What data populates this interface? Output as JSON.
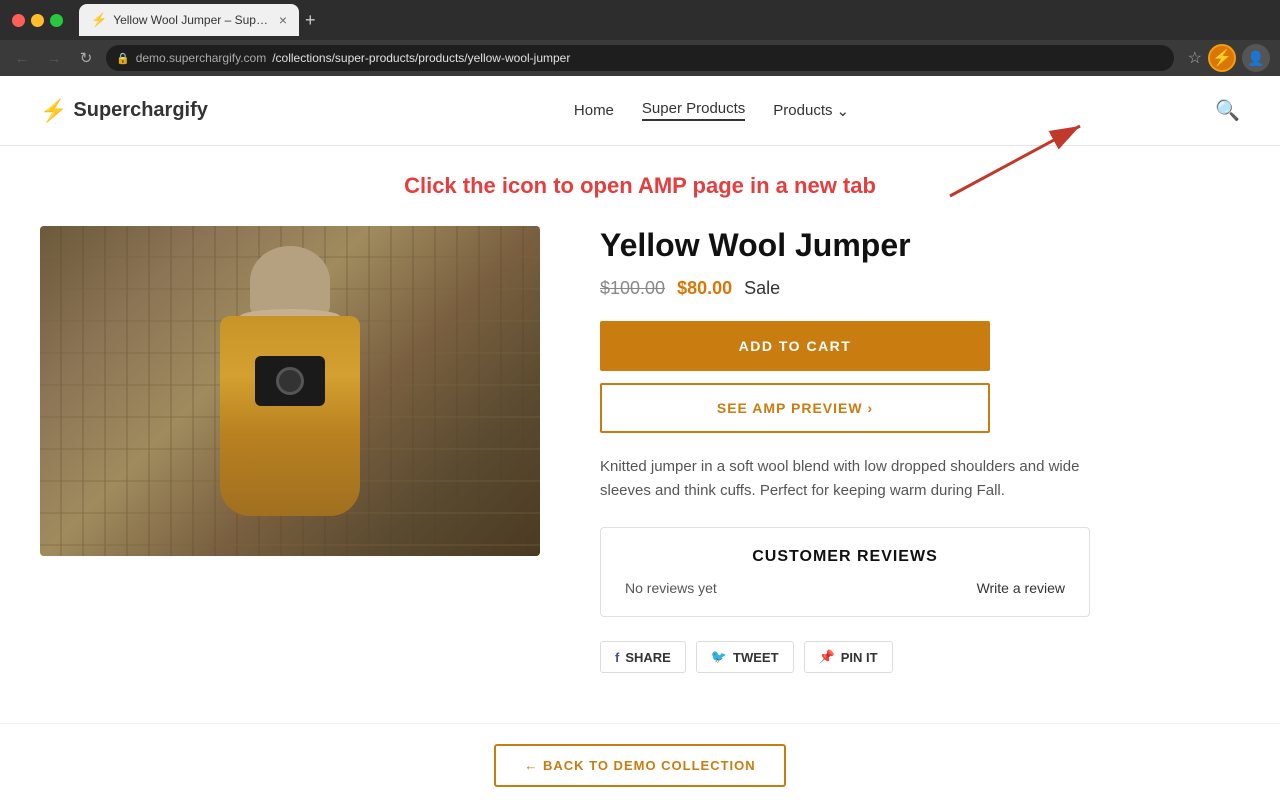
{
  "browser": {
    "tab_title": "Yellow Wool Jumper – Supercha...",
    "tab_favicon": "⚡",
    "address": "demo.superchargify.com/collections/super-products/products/yellow-wool-jumper",
    "address_domain": "demo.superchargify.com",
    "address_path": "/collections/super-products/products/yellow-wool-jumper",
    "new_tab_label": "+"
  },
  "annotation": {
    "text": "Click the icon to open AMP page in a new tab"
  },
  "site": {
    "logo_bolt": "⚡",
    "logo_name": "Superchargify",
    "nav": [
      {
        "label": "Home",
        "active": false
      },
      {
        "label": "Super Products",
        "active": true
      },
      {
        "label": "Products",
        "active": false,
        "dropdown": true
      }
    ]
  },
  "product": {
    "title": "Yellow Wool Jumper",
    "price_original": "$100.00",
    "price_sale": "$80.00",
    "price_badge": "Sale",
    "add_to_cart": "ADD TO CART",
    "see_amp": "SEE AMP PREVIEW ›",
    "description": "Knitted jumper in a soft wool blend with low dropped shoulders and wide sleeves and think cuffs. Perfect for keeping warm during Fall."
  },
  "reviews": {
    "title": "CUSTOMER REVIEWS",
    "no_reviews": "No reviews yet",
    "write_review": "Write a review"
  },
  "social": {
    "share": "SHARE",
    "tweet": "TWEET",
    "pin": "PIN IT"
  },
  "back": {
    "label": "← BACK TO DEMO COLLECTION"
  }
}
